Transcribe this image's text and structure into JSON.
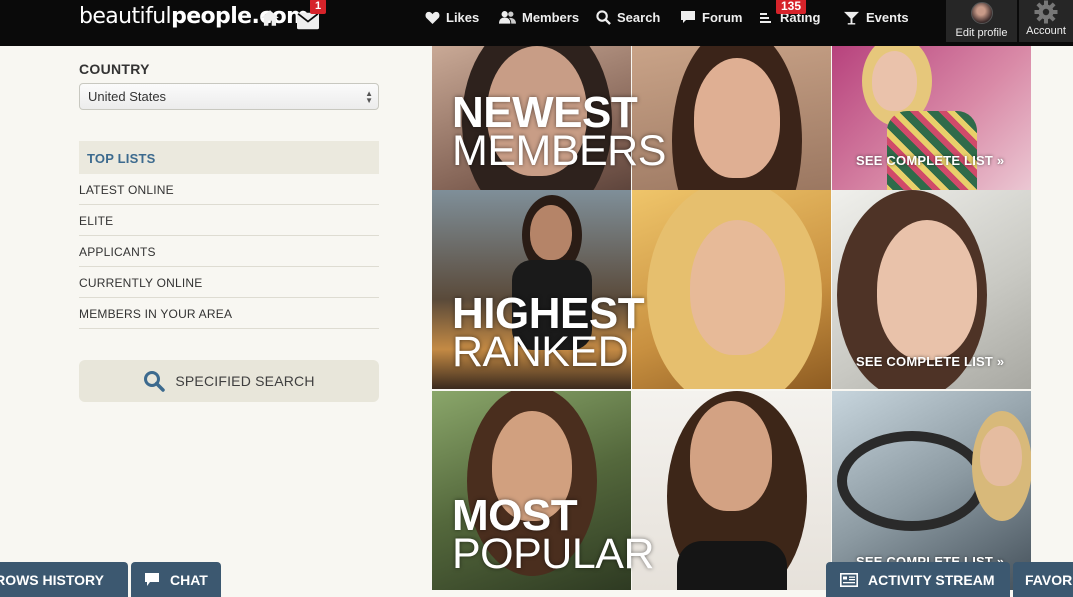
{
  "header": {
    "logo_part1": "beautiful",
    "logo_part2": "people.com",
    "mail_badge": "1",
    "rating_badge": "135",
    "nav": {
      "likes": "Likes",
      "members": "Members",
      "search": "Search",
      "forum": "Forum",
      "rating": "Rating",
      "events": "Events"
    },
    "edit_profile": "Edit profile",
    "account": "Account"
  },
  "sidebar": {
    "country_label": "COUNTRY",
    "country_value": "United States",
    "top_lists_label": "TOP LISTS",
    "items": [
      "LATEST ONLINE",
      "ELITE",
      "APPLICANTS",
      "CURRENTLY ONLINE",
      "MEMBERS IN YOUR AREA"
    ],
    "specified_search": "SPECIFIED SEARCH"
  },
  "sections": [
    {
      "line1": "NEWEST",
      "line2": "MEMBERS",
      "link": "SEE COMPLETE LIST »"
    },
    {
      "line1": "HIGHEST",
      "line2": "RANKED",
      "link": "SEE COMPLETE LIST »"
    },
    {
      "line1": "MOST",
      "line2": "POPULAR",
      "link": "SEE COMPLETE LIST »"
    }
  ],
  "bottom_bar": {
    "history": "ROWS HISTORY",
    "chat": "CHAT",
    "activity": "ACTIVITY STREAM",
    "favorites": "FAVOR"
  },
  "colors": {
    "topbar": "#0a0a0a",
    "badge": "#d6232a",
    "accent_blue": "#3c6a8e",
    "bottom_tab": "#3c5870",
    "page_bg": "#f8f7f2"
  }
}
